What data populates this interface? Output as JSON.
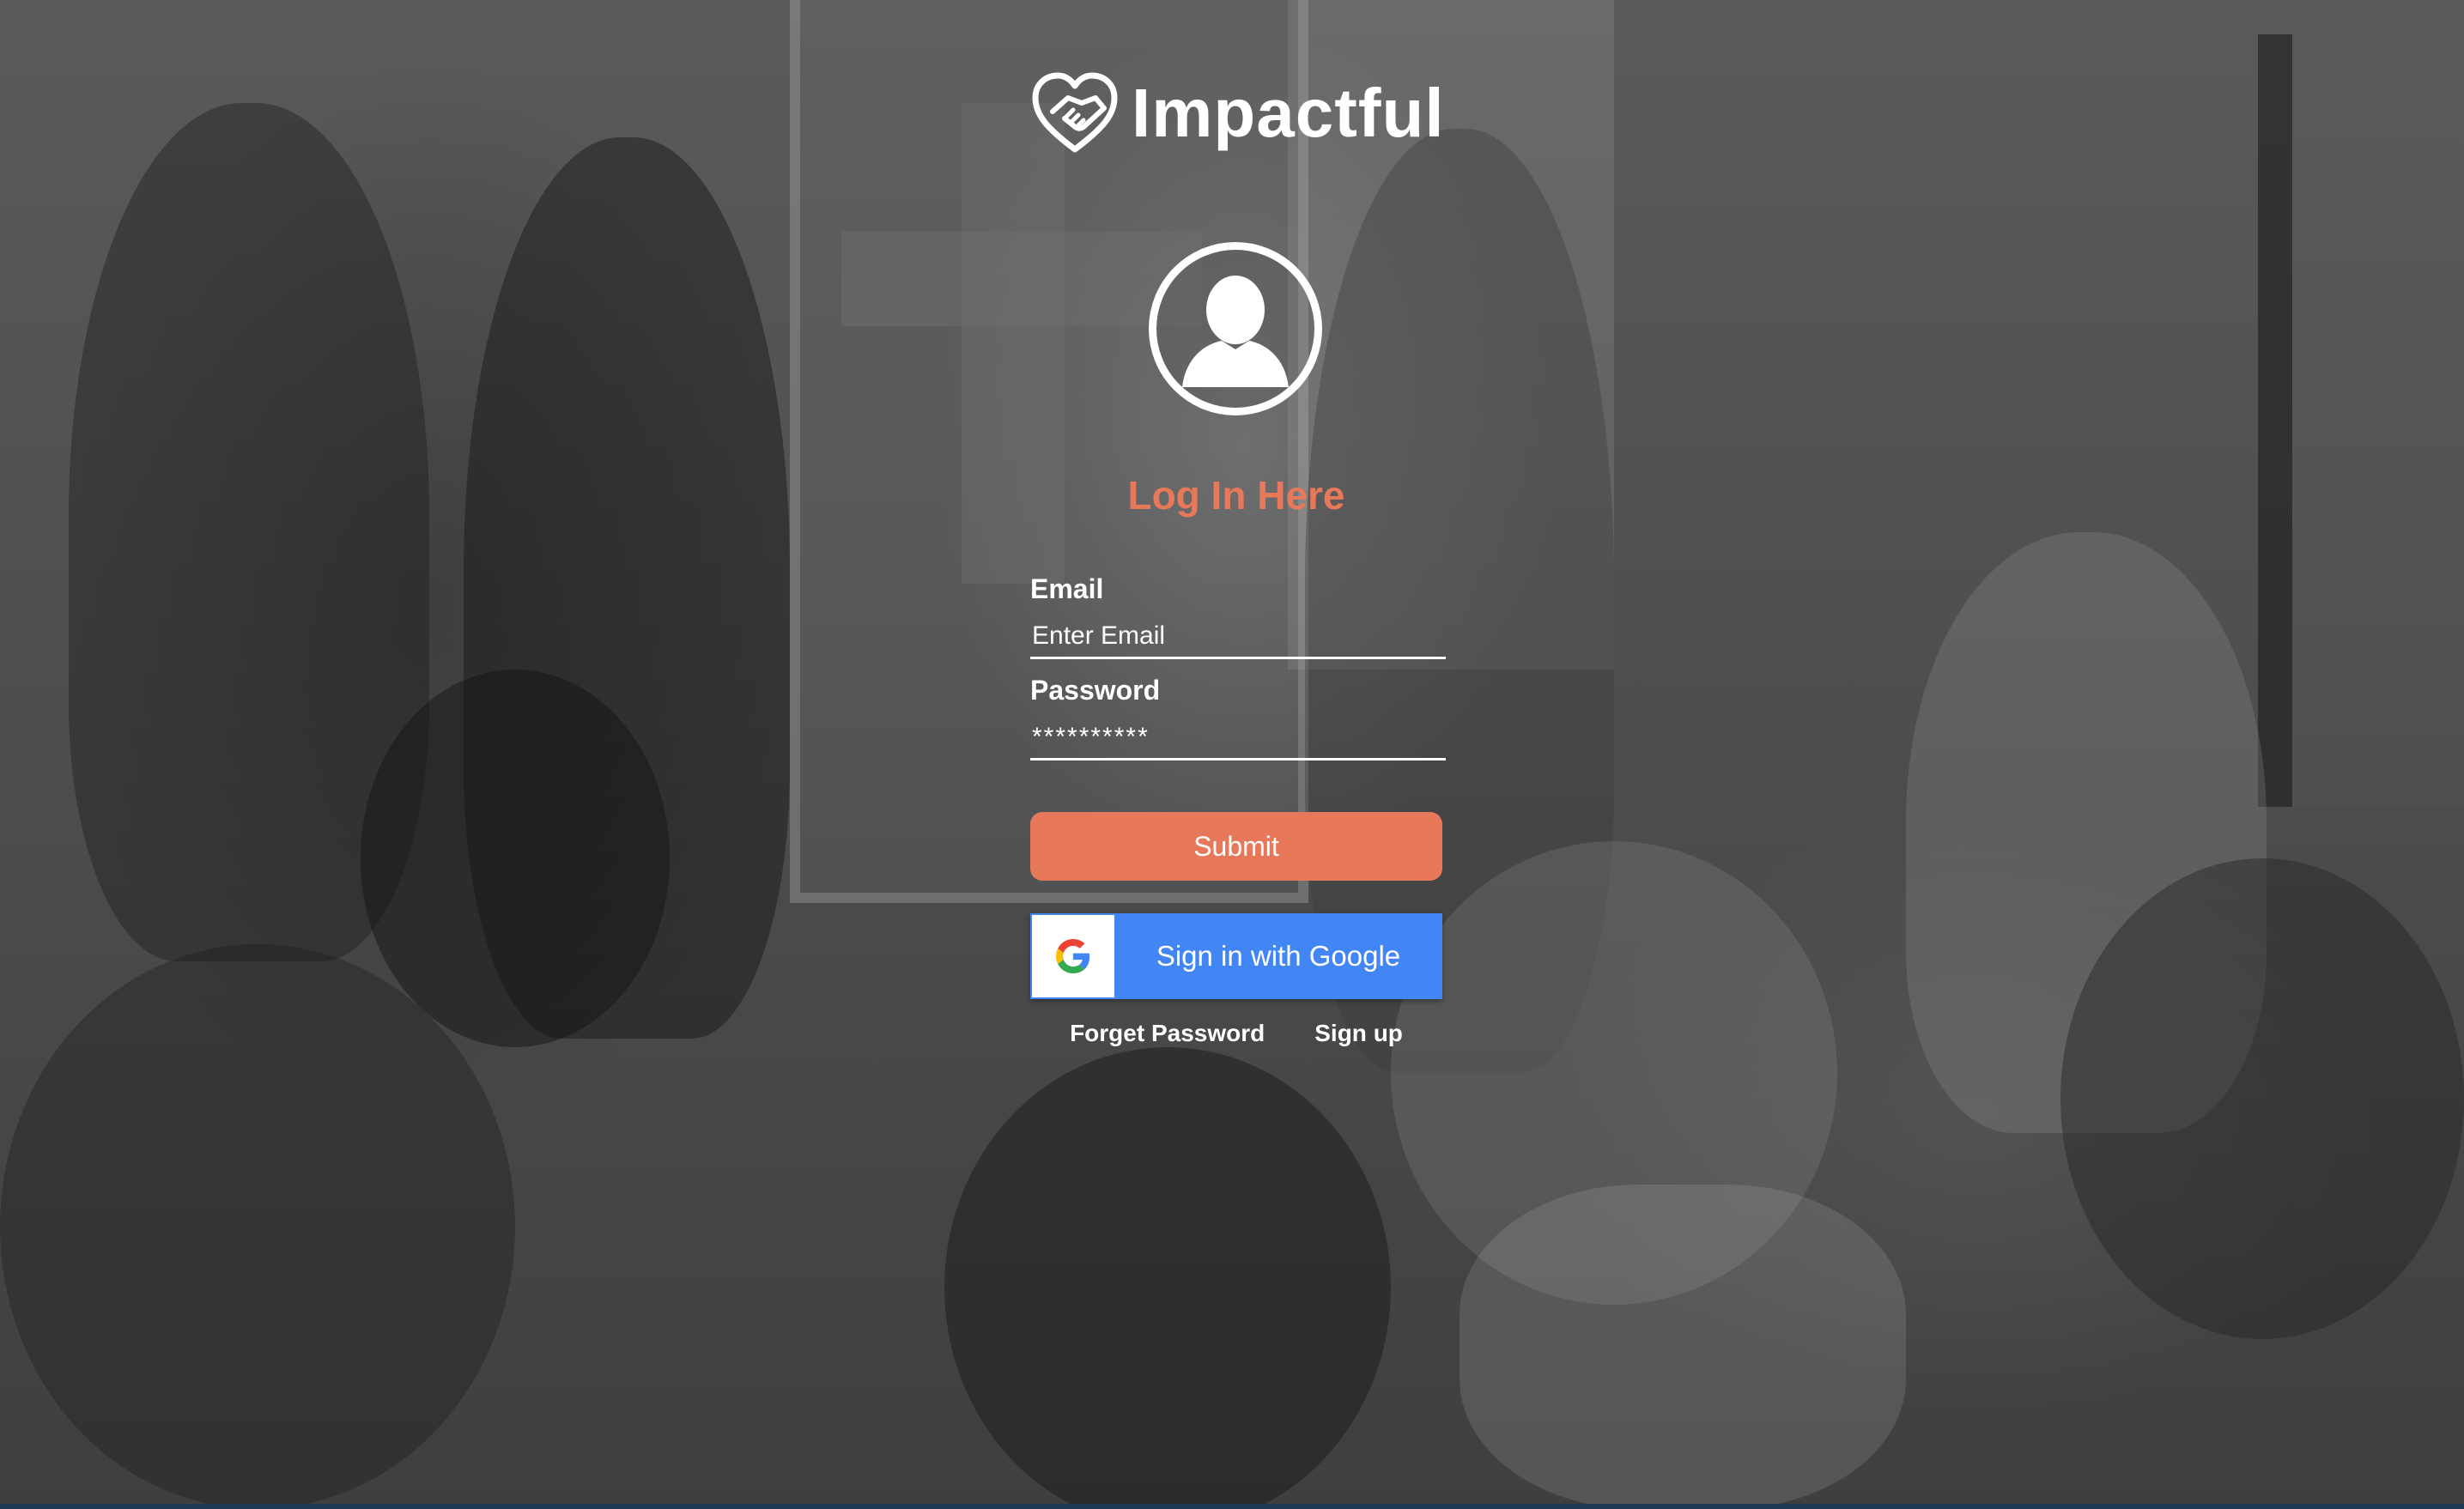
{
  "brand": {
    "name": "Impactful",
    "logo_icon": "heart-handshake-icon"
  },
  "login": {
    "avatar_icon": "user-avatar-icon",
    "heading": "Log In Here",
    "email": {
      "label": "Email",
      "placeholder": "Enter Email",
      "value": ""
    },
    "password": {
      "label": "Password",
      "value": "**********"
    },
    "submit_label": "Submit",
    "google": {
      "label": "Sign in with Google",
      "icon": "google-g-icon",
      "color": "#4285f4"
    },
    "links": {
      "forgot": "Forget Password",
      "signup": "Sign up"
    }
  },
  "colors": {
    "accent": "#e8785a",
    "text": "#ffffff"
  }
}
